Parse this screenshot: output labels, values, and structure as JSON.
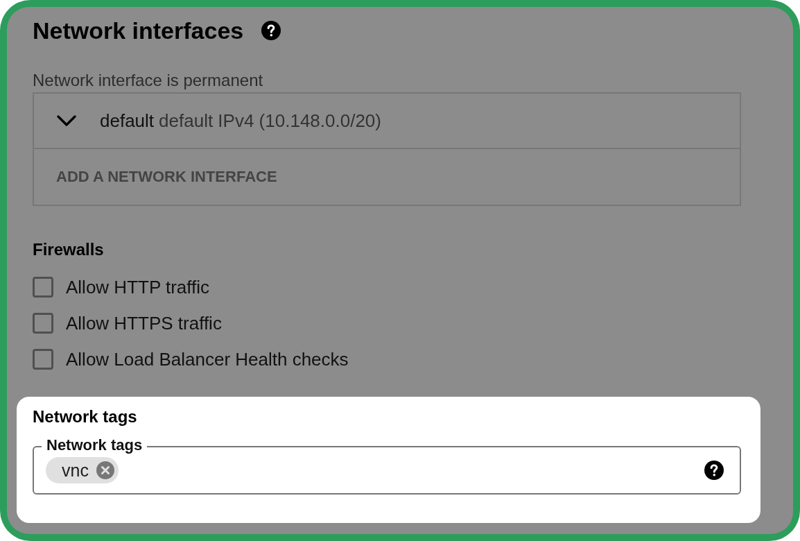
{
  "network_interfaces": {
    "title": "Network interfaces",
    "note": "Network interface is permanent",
    "interfaces": [
      {
        "name": "default",
        "detail": "default IPv4 (10.148.0.0/20)",
        "expanded": false
      }
    ],
    "add_button": "ADD A NETWORK INTERFACE"
  },
  "firewalls": {
    "title": "Firewalls",
    "options": [
      {
        "label": "Allow HTTP traffic",
        "checked": false
      },
      {
        "label": "Allow HTTPS traffic",
        "checked": false
      },
      {
        "label": "Allow Load Balancer Health checks",
        "checked": false
      }
    ]
  },
  "network_tags": {
    "title": "Network tags",
    "field_label": "Network tags",
    "tags": [
      "vnc"
    ]
  }
}
